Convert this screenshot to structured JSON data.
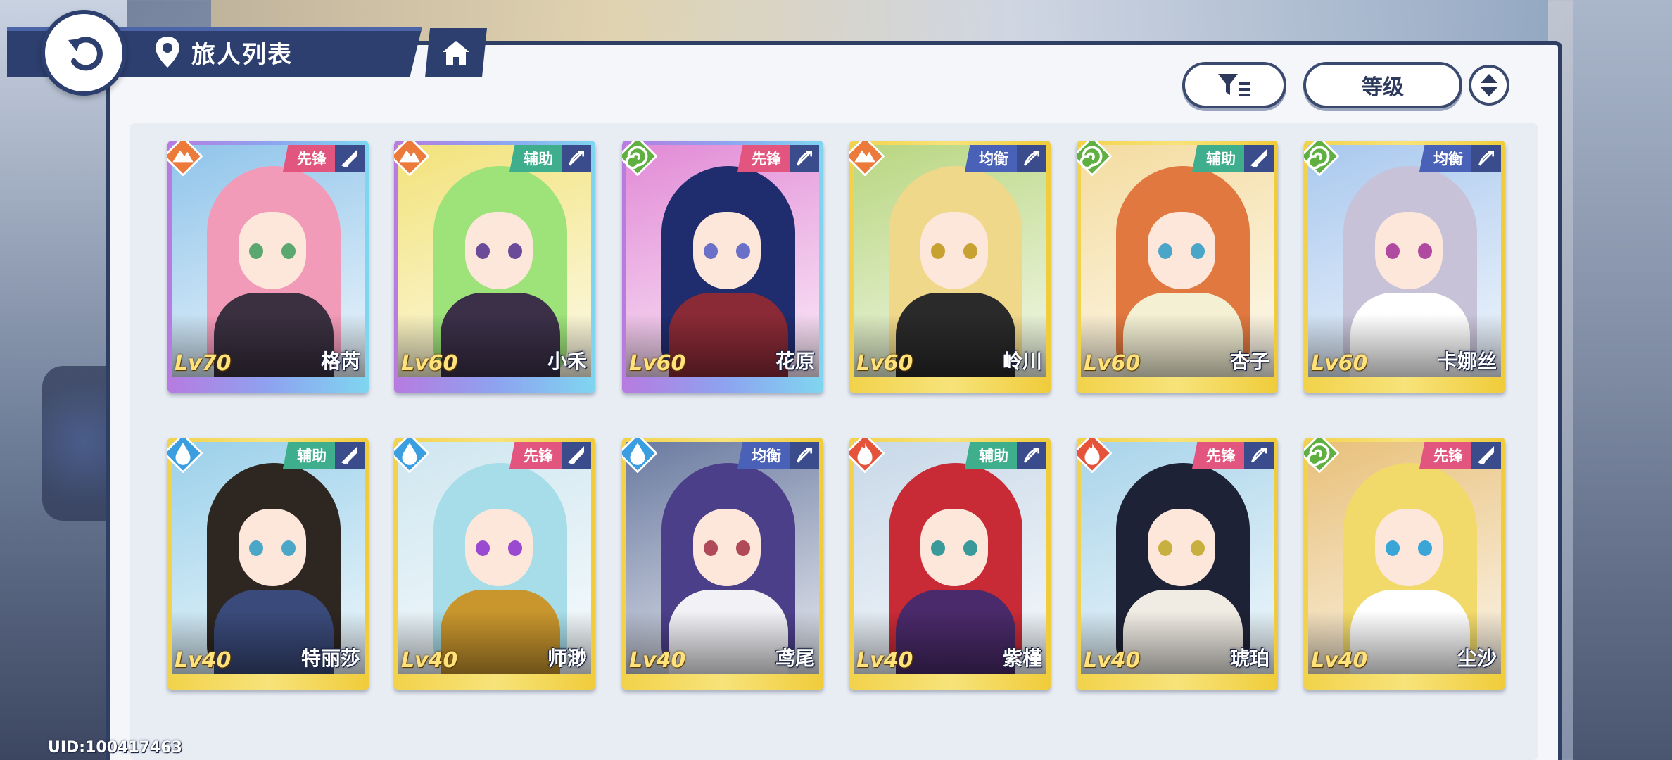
{
  "header": {
    "title": "旅人列表"
  },
  "controls": {
    "sort_label": "等级"
  },
  "uid": "UID:100417463",
  "colors": {
    "navy": "#2d3f6f",
    "role_vanguard": "#e2557f",
    "role_support": "#3fae8c",
    "role_balance": "#4a61b8",
    "elem_earth": "#ec7a3a",
    "elem_wind": "#5fb041",
    "elem_water": "#3b9ee0",
    "elem_fire": "#e5533a"
  },
  "cards": [
    {
      "name": "格芮",
      "level": "Lv70",
      "role": "先锋",
      "element": "earth",
      "weapon": "sword-icon",
      "frame": "purple",
      "hair": "#f29bb8",
      "eye": "#5aa870",
      "outfit": "#3a3040",
      "sky": "#8fc4ea"
    },
    {
      "name": "小禾",
      "level": "Lv60",
      "role": "辅助",
      "element": "earth",
      "weapon": "bow-icon",
      "frame": "purple",
      "hair": "#9ee27a",
      "eye": "#6c4a9a",
      "outfit": "#3b3048",
      "sky": "#f2e27a"
    },
    {
      "name": "花原",
      "level": "Lv60",
      "role": "先锋",
      "element": "wind",
      "weapon": "bow-icon",
      "frame": "purple",
      "hair": "#1f2c6e",
      "eye": "#6a6fc8",
      "outfit": "#8a2a36",
      "sky": "#e28ad6"
    },
    {
      "name": "岭川",
      "level": "Lv60",
      "role": "均衡",
      "element": "earth",
      "weapon": "bow-icon",
      "frame": "gold",
      "hair": "#f0d88a",
      "eye": "#c8a230",
      "outfit": "#2a2a2a",
      "sky": "#b8d680"
    },
    {
      "name": "杏子",
      "level": "Lv60",
      "role": "辅助",
      "element": "wind",
      "weapon": "sword-icon",
      "frame": "gold",
      "hair": "#e07840",
      "eye": "#4aa6c8",
      "outfit": "#f4f0d4",
      "sky": "#f4dca0"
    },
    {
      "name": "卡娜丝",
      "level": "Lv60",
      "role": "均衡",
      "element": "wind",
      "weapon": "bow-icon",
      "frame": "gold",
      "hair": "#c7c2d8",
      "eye": "#b04aa0",
      "outfit": "#ffffff",
      "sky": "#a9c8ee"
    },
    {
      "name": "特丽莎",
      "level": "Lv40",
      "role": "辅助",
      "element": "water",
      "weapon": "sword-icon",
      "frame": "gold",
      "hair": "#2e2620",
      "eye": "#4aa7c8",
      "outfit": "#3a4a7a",
      "sky": "#9ad0ea"
    },
    {
      "name": "师渺",
      "level": "Lv40",
      "role": "先锋",
      "element": "water",
      "weapon": "sword-icon",
      "frame": "gold",
      "hair": "#a7dde8",
      "eye": "#9a4ad0",
      "outfit": "#c9962e",
      "sky": "#cfe6f0"
    },
    {
      "name": "鸢尾",
      "level": "Lv40",
      "role": "均衡",
      "element": "water",
      "weapon": "bow-icon",
      "frame": "gold",
      "hair": "#4b3f8a",
      "eye": "#b04a5a",
      "outfit": "#f2f2f6",
      "sky": "#6a7aa0"
    },
    {
      "name": "紫槿",
      "level": "Lv40",
      "role": "辅助",
      "element": "fire",
      "weapon": "bow-icon",
      "frame": "gold",
      "hair": "#c82a36",
      "eye": "#3a9a9a",
      "outfit": "#4a2a6a",
      "sky": "#c8d8e8"
    },
    {
      "name": "琥珀",
      "level": "Lv40",
      "role": "先锋",
      "element": "fire",
      "weapon": "bow-icon",
      "frame": "gold",
      "hair": "#1e2236",
      "eye": "#c8b040",
      "outfit": "#f0ece4",
      "sky": "#a9d4ea"
    },
    {
      "name": "尘沙",
      "level": "Lv40",
      "role": "先锋",
      "element": "wind",
      "weapon": "sword-icon",
      "frame": "gold",
      "hair": "#f2da6a",
      "eye": "#3aa6d8",
      "outfit": "#ffffff",
      "sky": "#e8c07a"
    }
  ]
}
